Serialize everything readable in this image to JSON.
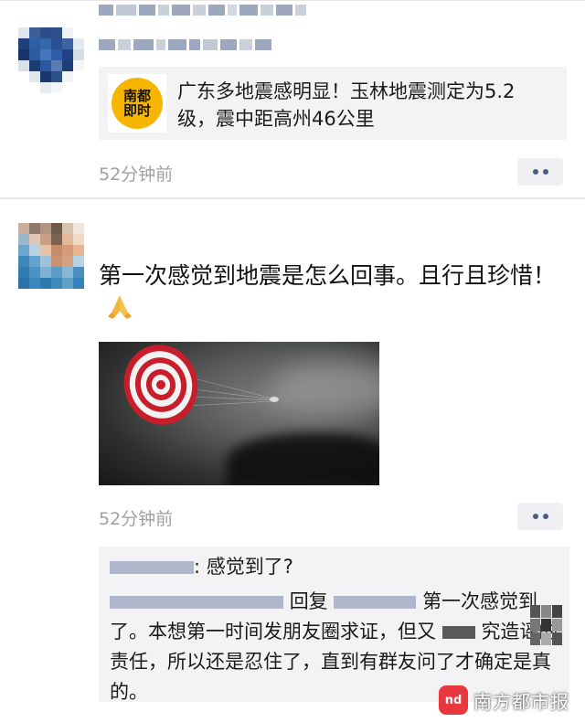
{
  "post1": {
    "share_title": "广东多地震感明显！玉林地震测定为5.2级，震中距高州46公里",
    "share_logo_line1": "南都",
    "share_logo_line2": "即时",
    "time": "52分钟前"
  },
  "post2": {
    "text": "第一次感觉到地震是怎么回事。且行且珍惜！",
    "emoji": "folded-hands",
    "time": "52分钟前",
    "comments": {
      "first": ": 感觉到了?",
      "second_prefix": "回复",
      "second_text": "第一次感觉到了。本想第一时间发朋友圈求证，但又",
      "second_text_tail": "究造谣的责任，所以还是忍住了，直到有群友问了才确定是真的。"
    }
  },
  "watermark": {
    "logo": "nd",
    "text": "南方都市报"
  },
  "colors": {
    "link_blue": "#4a5a80",
    "meta_gray": "#a0a0a0",
    "card_bg": "#f3f3f5",
    "logo_yellow": "#f7b500",
    "watermark_red": "#e8383d"
  }
}
